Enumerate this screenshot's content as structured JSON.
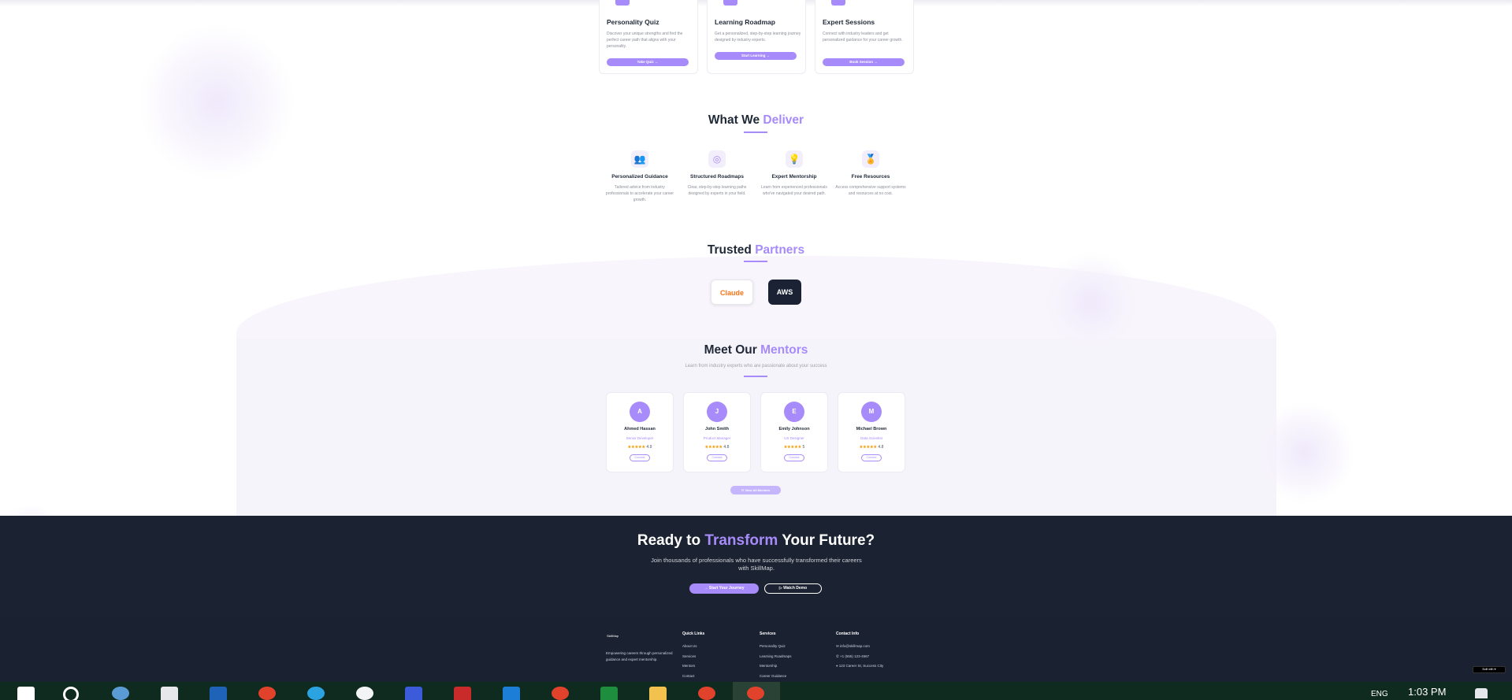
{
  "top_cards": [
    {
      "title": "Personality Quiz",
      "desc": "Discover your unique strengths and find the perfect career path that aligns with your personality.",
      "button": "Take Quiz →"
    },
    {
      "title": "Learning Roadmap",
      "desc": "Get a personalized, step-by-step learning journey designed by industry experts.",
      "button": "Start Learning →"
    },
    {
      "title": "Expert Sessions",
      "desc": "Connect with industry leaders and get personalized guidance for your career growth.",
      "button": "Book Session →"
    }
  ],
  "deliver": {
    "title_plain": "What We",
    "title_accent": "Deliver",
    "items": [
      {
        "icon": "users-icon",
        "glyph": "👥",
        "title": "Personalized Guidance",
        "desc": "Tailored advice from industry professionals to accelerate your career growth."
      },
      {
        "icon": "target-icon",
        "glyph": "◎",
        "title": "Structured Roadmaps",
        "desc": "Clear, step-by-step learning paths designed by experts in your field."
      },
      {
        "icon": "lightbulb-icon",
        "glyph": "💡",
        "title": "Expert Mentorship",
        "desc": "Learn from experienced professionals who've navigated your desired path."
      },
      {
        "icon": "award-icon",
        "glyph": "🏅",
        "title": "Free Resources",
        "desc": "Access comprehensive support systems and resources at no cost."
      }
    ]
  },
  "partners": {
    "title_plain": "Trusted",
    "title_accent": "Partners",
    "items": [
      "Claude",
      "AWS"
    ]
  },
  "mentors": {
    "title_plain": "Meet Our",
    "title_accent": "Mentors",
    "subtitle": "Learn from industry experts who are passionate about your success",
    "items": [
      {
        "initial": "A",
        "name": "Ahmed Hassan",
        "role": "Senior Developer",
        "stars": "★★★★★",
        "rating": "4.9",
        "button": "Connect"
      },
      {
        "initial": "J",
        "name": "John Smith",
        "role": "Product Manager",
        "stars": "★★★★★",
        "rating": "4.8",
        "button": "Connect"
      },
      {
        "initial": "E",
        "name": "Emily Johnson",
        "role": "UX Designer",
        "stars": "★★★★★",
        "rating": "5",
        "button": "Connect"
      },
      {
        "initial": "M",
        "name": "Michael Brown",
        "role": "Data Scientist",
        "stars": "★★★★★",
        "rating": "4.8",
        "button": "Connect"
      }
    ],
    "view_all": "⚇ View All Mentors"
  },
  "cta": {
    "title_a": "Ready to",
    "title_accent": "Transform",
    "title_b": "Your Future?",
    "text": "Join thousands of professionals who have successfully transformed their careers with SkillMap.",
    "primary": "→ Start Your Journey",
    "secondary": "▷ Watch Demo"
  },
  "footer": {
    "logo": "SkillMap",
    "tagline": "Empowering careers through personalized guidance and expert mentorship.",
    "quick_links": {
      "heading": "Quick Links",
      "items": [
        "About Us",
        "Services",
        "Mentors",
        "Contact"
      ]
    },
    "services": {
      "heading": "Services",
      "items": [
        "Personality Quiz",
        "Learning Roadmaps",
        "Mentorship",
        "Career Guidance"
      ]
    },
    "contact": {
      "heading": "Contact Info",
      "items": [
        "✉ info@skillmap.com",
        "✆ +1 (555) 123-4567",
        "⌖ 123 Career St, Success City"
      ]
    },
    "built_with": "Built with ♥"
  },
  "taskbar": {
    "time": "1:03 PM",
    "lang": "ENG"
  },
  "colors": {
    "accent": "#a78bfa",
    "dark": "#1b2231",
    "taskbar": "#0f2a1f"
  }
}
